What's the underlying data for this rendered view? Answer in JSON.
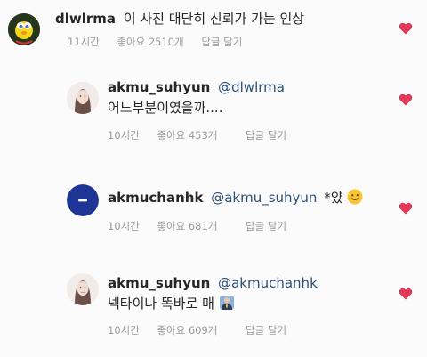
{
  "comments": [
    {
      "username": "dlwlrma",
      "mention": "",
      "text": "이 사진 대단히 신뢰가 가는 인상",
      "line2": "",
      "time": "11시간",
      "likes": "좋아요 2510개",
      "reply": "답글 달기",
      "avatar_icon": "tweety-avatar-icon"
    },
    {
      "username": "akmu_suhyun",
      "mention": "@dlwlrma",
      "text": "",
      "line2": "어느부분이였을까....",
      "time": "10시간",
      "likes": "좋아요 453개",
      "reply": "답글 달기",
      "avatar_icon": "profile-photo-icon"
    },
    {
      "username": "akmuchanhk",
      "mention": "@akmu_suhyun",
      "text": "*얐",
      "line2": "",
      "time": "10시간",
      "likes": "좋아요 681개",
      "reply": "답글 달기",
      "avatar_icon": "blue-dash-avatar-icon"
    },
    {
      "username": "akmu_suhyun",
      "mention": "@akmuchanhk",
      "text": "",
      "line2": "넥타이나 똑바로 매",
      "time": "10시간",
      "likes": "좋아요 609개",
      "reply": "답글 달기",
      "avatar_icon": "profile-photo-icon"
    }
  ],
  "colors": {
    "heart": "#e0395a",
    "mention": "#2a4d78",
    "meta": "#9a9a9a"
  }
}
